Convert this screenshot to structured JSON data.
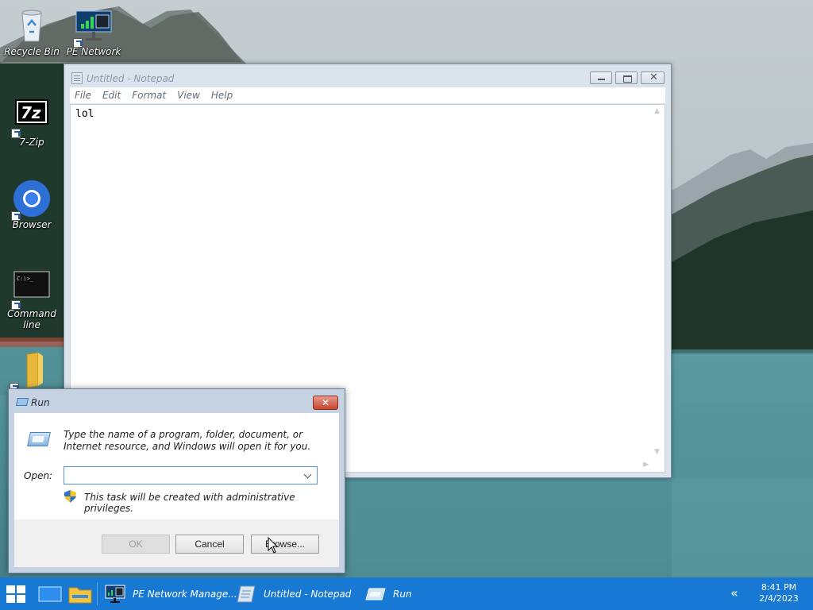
{
  "desktop": {
    "icons": [
      {
        "label": "Recycle Bin",
        "icon": "recycle-bin-icon"
      },
      {
        "label": "PE Network Manager",
        "icon": "pe-network-icon"
      },
      {
        "label": "7-Zip",
        "icon": "7zip-icon"
      },
      {
        "label": "Browser",
        "icon": "browser-icon"
      },
      {
        "label": "Command line",
        "icon": "command-line-icon"
      },
      {
        "label": "",
        "icon": "folder-icon"
      }
    ]
  },
  "notepad": {
    "title": "Untitled - Notepad",
    "menu": [
      "File",
      "Edit",
      "Format",
      "View",
      "Help"
    ],
    "content": "lol"
  },
  "run_dialog": {
    "title": "Run",
    "close_label": "✕",
    "description": "Type the name of a program, folder, document, or Internet resource, and Windows will open it for you.",
    "open_label": "Open:",
    "open_value": "",
    "admin_note": "This task will be created with administrative privileges.",
    "ok_label": "OK",
    "cancel_label": "Cancel",
    "browse_label": "Browse..."
  },
  "taskbar": {
    "tasks": [
      {
        "label": "PE Network Manage...",
        "icon": "pe-network-icon"
      },
      {
        "label": "Untitled - Notepad",
        "icon": "notepad-icon"
      },
      {
        "label": "Run",
        "icon": "run-icon"
      }
    ],
    "chevron": "«",
    "time": "8:41 PM",
    "date": "2/4/2023"
  },
  "colors": {
    "taskbar": "#1879d4",
    "run_close": "#c8452f",
    "combo_border": "#5a8fd1"
  }
}
